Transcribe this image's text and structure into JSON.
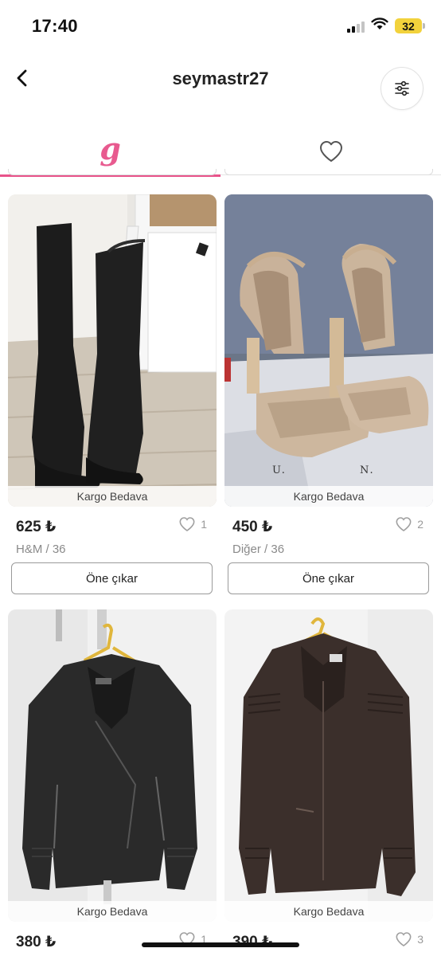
{
  "status_bar": {
    "time": "17:40",
    "battery": "32"
  },
  "header": {
    "title": "seymastr27"
  },
  "tabs": [
    {
      "label": "g",
      "active": true,
      "icon": "brand-logo"
    },
    {
      "icon": "heart-icon",
      "active": false
    }
  ],
  "colors": {
    "accent": "#e8538a",
    "text": "#222222",
    "muted": "#8a8a8a"
  },
  "products": [
    {
      "image": "black over-the-knee suede boots",
      "shipping": "Kargo Bedava",
      "price": "625 ₺",
      "likes": "1",
      "meta": "H&M / 36",
      "action": "Öne çıkar"
    },
    {
      "image": "nude platform ankle-strap heels",
      "shipping": "Kargo Bedava",
      "price": "450 ₺",
      "likes": "2",
      "meta": "Diğer / 36",
      "action": "Öne çıkar"
    },
    {
      "image": "black leather biker jacket",
      "shipping": "Kargo Bedava",
      "price": "380 ₺",
      "likes": "1"
    },
    {
      "image": "dark brown leather jacket",
      "shipping": "Kargo Bedava",
      "price": "390 ₺",
      "likes": "3"
    }
  ]
}
